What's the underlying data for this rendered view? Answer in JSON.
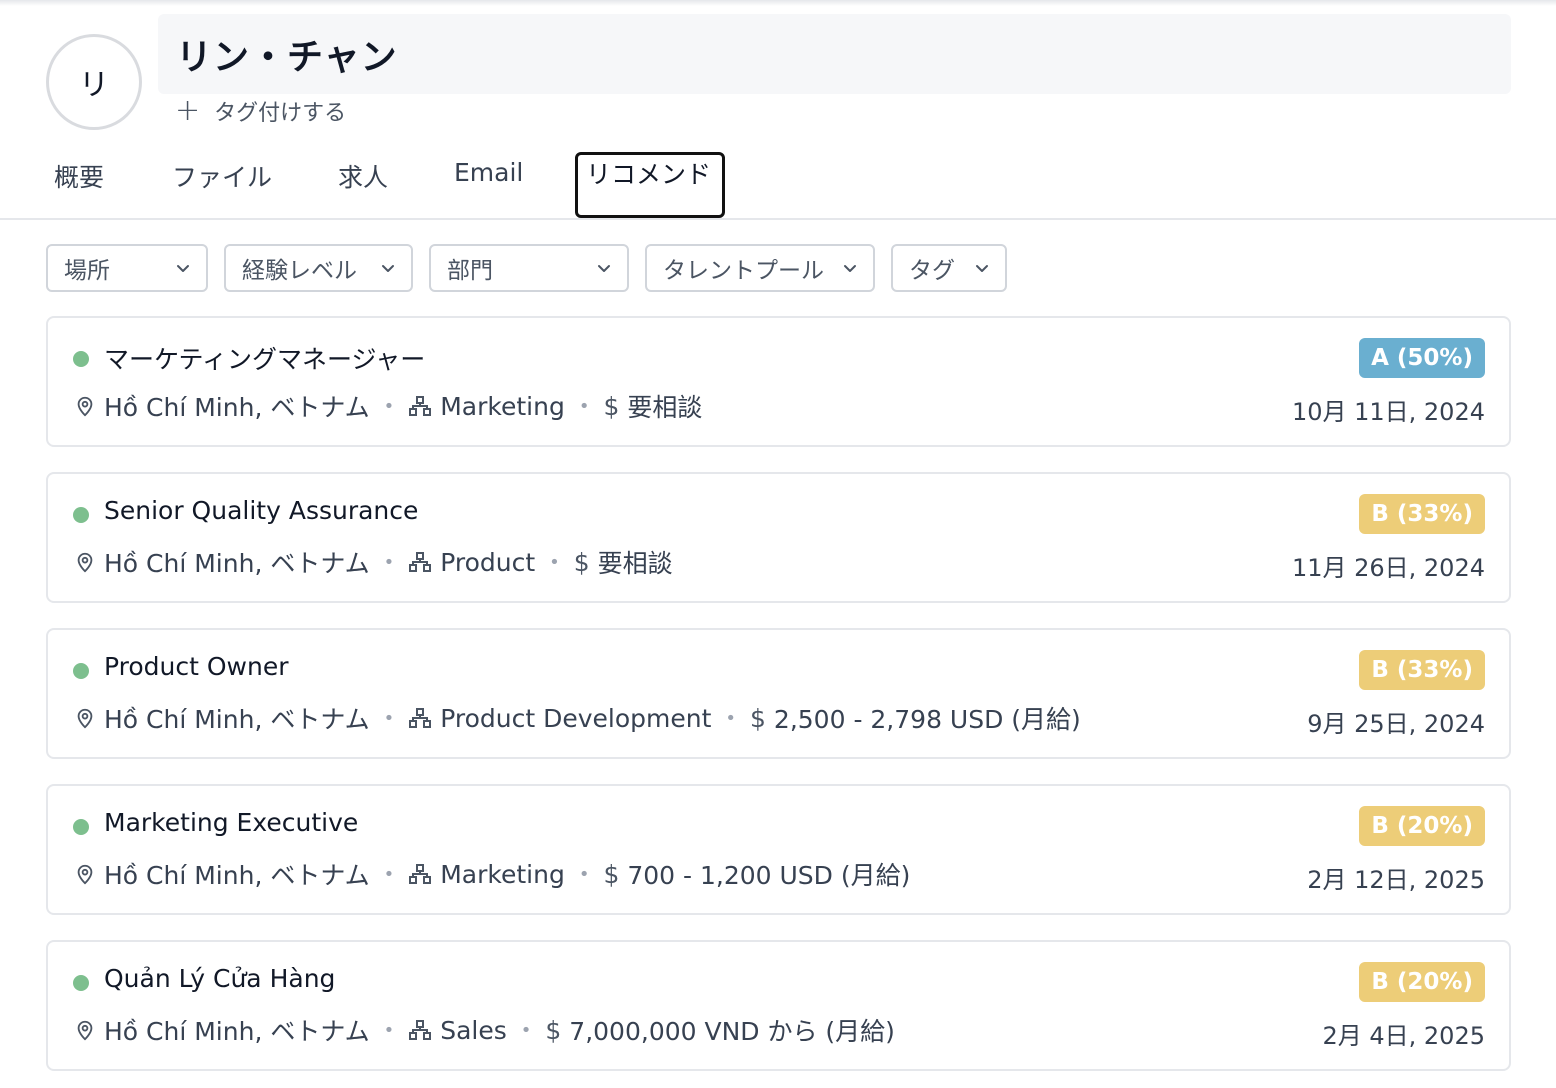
{
  "profile": {
    "avatar_initial": "リ",
    "name": "リン・チャン",
    "add_tag_label": "タグ付けする"
  },
  "tabs": [
    {
      "label": "概要",
      "active": false
    },
    {
      "label": "ファイル",
      "active": false
    },
    {
      "label": "求人",
      "active": false
    },
    {
      "label": "Email",
      "active": false
    },
    {
      "label": "リコメンド",
      "active": true
    }
  ],
  "filters": [
    {
      "label": "場所"
    },
    {
      "label": "経験レベル"
    },
    {
      "label": "部門"
    },
    {
      "label": "タレントプール"
    },
    {
      "label": "タグ"
    }
  ],
  "colors": {
    "status_dot": "#7dbf8e",
    "grade_a": "#6aafd0",
    "grade_b": "#edcd78"
  },
  "jobs": [
    {
      "title": "マーケティングマネージャー",
      "location": "Hồ Chí Minh, ベトナム",
      "department": "Marketing",
      "salary": "要相談",
      "grade": "A (50%)",
      "grade_color": "#6aafd0",
      "date": "10月 11日, 2024"
    },
    {
      "title": "Senior Quality Assurance",
      "location": "Hồ Chí Minh, ベトナム",
      "department": "Product",
      "salary": "要相談",
      "grade": "B (33%)",
      "grade_color": "#edcd78",
      "date": "11月 26日, 2024"
    },
    {
      "title": "Product Owner",
      "location": "Hồ Chí Minh, ベトナム",
      "department": "Product Development",
      "salary": "2,500 - 2,798 USD (月給)",
      "grade": "B (33%)",
      "grade_color": "#edcd78",
      "date": "9月 25日, 2024"
    },
    {
      "title": "Marketing Executive",
      "location": "Hồ Chí Minh, ベトナム",
      "department": "Marketing",
      "salary": "700 - 1,200 USD (月給)",
      "grade": "B (20%)",
      "grade_color": "#edcd78",
      "date": "2月 12日, 2025"
    },
    {
      "title": "Quản Lý Cửa Hàng",
      "location": "Hồ Chí Minh, ベトナム",
      "department": "Sales",
      "salary": "7,000,000 VND から (月給)",
      "grade": "B (20%)",
      "grade_color": "#edcd78",
      "date": "2月 4日, 2025"
    }
  ]
}
